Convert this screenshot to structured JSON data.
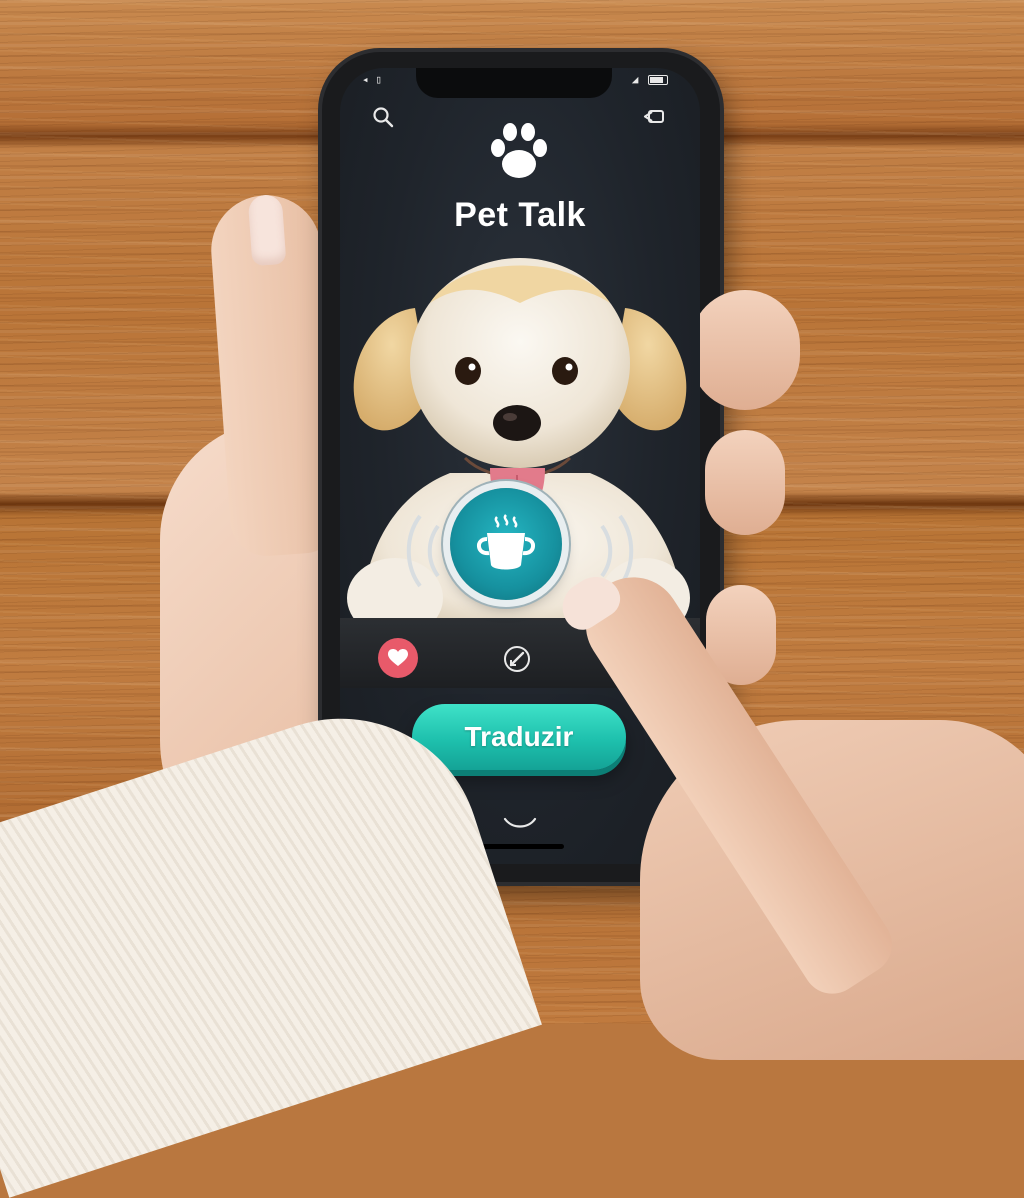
{
  "app": {
    "title": "Pet Talk",
    "translate_label": "Traduzir"
  },
  "status_bar": {
    "left_icons": [
      "signal-icon",
      "sim-icon"
    ],
    "right_icons": [
      "wifi-icon",
      "battery-icon"
    ]
  },
  "header": {
    "left_icon": "search-icon",
    "right_icon": "back-icon",
    "logo_icon": "paw-icon"
  },
  "controls": {
    "record_icon": "cup-icon",
    "heart_icon": "heart-icon",
    "edit_icon": "edit-icon",
    "home_icon": "smile-icon"
  },
  "colors": {
    "accent": "#1ec0ad",
    "record": "#16919f",
    "heart": "#e85a6a",
    "screen_bg": "#1f242b"
  }
}
